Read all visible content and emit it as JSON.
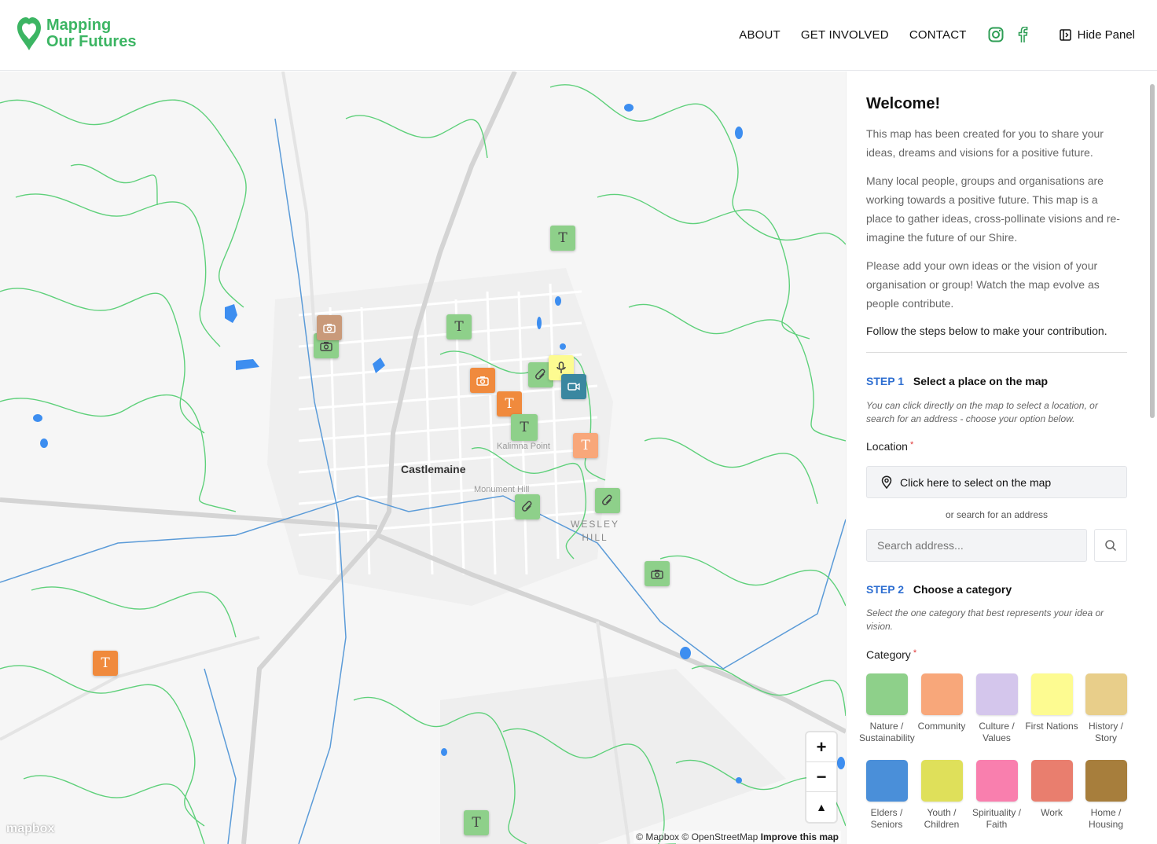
{
  "app": {
    "name_line1": "Mapping",
    "name_line2": "Our Futures",
    "brand_color": "#3cb563"
  },
  "nav": {
    "about": "ABOUT",
    "get_involved": "GET INVOLVED",
    "contact": "CONTACT",
    "hide_panel": "Hide Panel"
  },
  "map": {
    "town": "Castlemaine",
    "place_kalimna": "Kalimna Point",
    "place_monument": "Monument Hill",
    "suburb_line1": "WESLEY",
    "suburb_line2": "HILL",
    "logo": "mapbox",
    "attribution_mapbox": "© Mapbox",
    "attribution_osm": "© OpenStreetMap",
    "attribution_improve": "Improve this map",
    "zoom_in": "+",
    "zoom_out": "−",
    "compass": "▲",
    "marker_text_glyph": "T",
    "marker_types": [
      "text-icon",
      "camera-icon",
      "paperclip-icon",
      "microphone-icon",
      "video-icon"
    ]
  },
  "panel": {
    "welcome": "Welcome!",
    "p1": "This map has been created for you to share your ideas, dreams and visions for a positive future.",
    "p2": "Many local people, groups and organisations are working towards a positive future. This map is a place to gather ideas, cross-pollinate visions and re-imagine the future of our Shire.",
    "p3": "Please add your own ideas or the vision of your organisation or group! Watch the map evolve as people contribute.",
    "p4": "Follow the steps below to make your contribution.",
    "step1_num": "STEP 1",
    "step1_title": "Select a place on the map",
    "step1_hint": "You can click directly on the map to select a location, or search for an address - choose your option below.",
    "location_label": "Location",
    "required_mark": "*",
    "location_button": "Click here to select on the map",
    "or_search": "or search for an address",
    "search_placeholder": "Search address...",
    "step2_num": "STEP 2",
    "step2_title": "Choose a category",
    "step2_hint": "Select the one category that best represents your idea or vision.",
    "category_label": "Category",
    "categories": [
      {
        "label": "Nature / Sustainability",
        "color": "#8ed08a"
      },
      {
        "label": "Community",
        "color": "#f8a77a"
      },
      {
        "label": "Culture / Values",
        "color": "#d4c6ec"
      },
      {
        "label": "First Nations",
        "color": "#fdfb91"
      },
      {
        "label": "History / Story",
        "color": "#e8ce8a"
      },
      {
        "label": "Elders / Seniors",
        "color": "#4a8fd9"
      },
      {
        "label": "Youth / Children",
        "color": "#dfe05a"
      },
      {
        "label": "Spirituality / Faith",
        "color": "#f97fae"
      },
      {
        "label": "Work",
        "color": "#e97e6e"
      },
      {
        "label": "Home / Housing",
        "color": "#a77e3c"
      }
    ]
  }
}
